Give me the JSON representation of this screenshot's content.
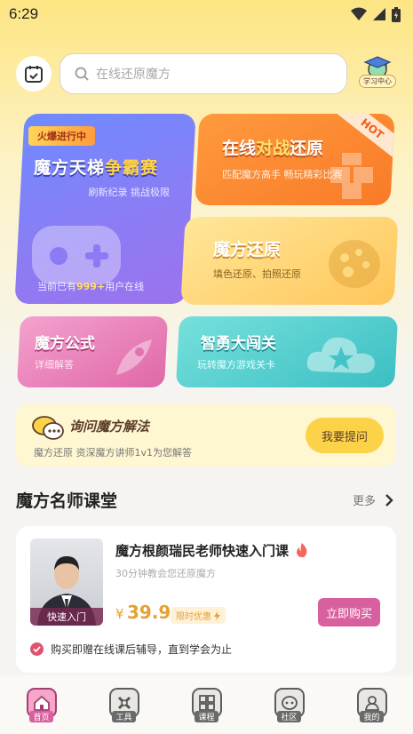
{
  "status_bar": {
    "time": "6:29"
  },
  "search": {
    "placeholder": "在线还原魔方"
  },
  "header": {
    "study_center_label": "学习中心"
  },
  "cards": {
    "ladder": {
      "badge": "火爆进行中",
      "title_main": "魔方天梯",
      "title_accent": "争霸赛",
      "subtitle": "刷新纪录 挑战极限",
      "online_prefix": "当前已有",
      "online_count": "999+",
      "online_suffix": "用户在线"
    },
    "online_restore": {
      "title_pre": "在线",
      "title_accent": "对战",
      "title_post": "还原",
      "subtitle": "匹配魔方高手 畅玩精彩比赛",
      "hot": "HOT"
    },
    "restore": {
      "title": "魔方还原",
      "subtitle": "填色还原、拍照还原"
    },
    "formula": {
      "title": "魔方公式",
      "subtitle": "详细解答"
    },
    "brave": {
      "title": "智勇大闯关",
      "subtitle": "玩转魔方游戏关卡"
    }
  },
  "ask": {
    "title": "询问魔方解法",
    "subtitle": "魔方还原 资深魔方讲师1v1为您解答",
    "button": "我要提问"
  },
  "section": {
    "title": "魔方名师课堂",
    "more": "更多"
  },
  "course": {
    "title": "魔方根颜瑞民老师快速入门课",
    "subtitle": "30分钟教会您还原魔方",
    "photo_tag": "快速入门",
    "price_symbol": "¥",
    "price": "39.9",
    "price_tag": "限时优惠",
    "buy_button": "立即购买",
    "bonus": "购买即赠在线课后辅导，直到学会为止"
  },
  "tabbar": [
    {
      "label": "首页",
      "icon": "home-icon",
      "active": true
    },
    {
      "label": "工具",
      "icon": "tools-icon",
      "active": false
    },
    {
      "label": "课程",
      "icon": "course-icon",
      "active": false
    },
    {
      "label": "社区",
      "icon": "community-icon",
      "active": false
    },
    {
      "label": "我的",
      "icon": "profile-icon",
      "active": false
    }
  ],
  "colors": {
    "accent_pink": "#d9609e",
    "accent_yellow": "#fcd248",
    "price_orange": "#e5a132"
  }
}
